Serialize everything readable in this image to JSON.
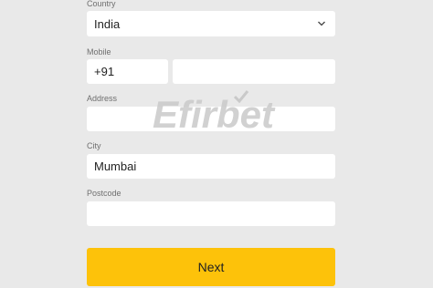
{
  "form": {
    "country_label": "Country",
    "country_value": "India",
    "mobile_label": "Mobile",
    "mobile_code": "+91",
    "mobile_number": "",
    "address_label": "Address",
    "address_value": "",
    "city_label": "City",
    "city_value": "Mumbai",
    "postcode_label": "Postcode",
    "postcode_value": "",
    "next_label": "Next"
  },
  "watermark": {
    "text": "Efirbet"
  },
  "icons": {
    "dropdown": "chevron-down-icon"
  },
  "colors": {
    "background": "#e9e9e9",
    "field": "#ffffff",
    "accent": "#fdc20a",
    "label": "#6f6f6f"
  }
}
